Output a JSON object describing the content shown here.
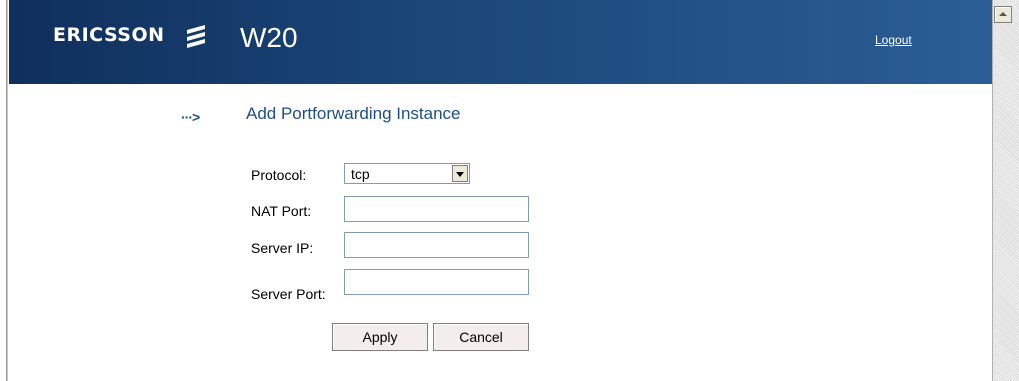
{
  "header": {
    "logo_text": "ERICSSON",
    "product": "W20",
    "logout_label": "Logout",
    "colors": {
      "start": "#0f2f5c",
      "end": "#2a5e95"
    }
  },
  "page": {
    "arrow": "···>",
    "title": "Add Portforwarding Instance"
  },
  "form": {
    "protocol_label": "Protocol:",
    "protocol_value": "tcp",
    "nat_port_label": "NAT Port:",
    "nat_port_value": "",
    "server_ip_label": "Server IP:",
    "server_ip_value": "",
    "server_port_label": "Server Port:",
    "server_port_value": ""
  },
  "buttons": {
    "apply_label": "Apply",
    "cancel_label": "Cancel"
  },
  "scrollbar": {
    "up_icon": "scroll-up-arrow"
  }
}
